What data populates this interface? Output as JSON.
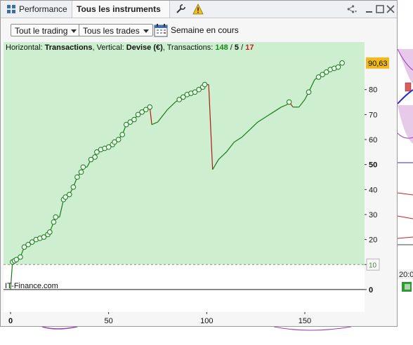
{
  "tabs": {
    "performance_label": "Performance",
    "instruments_label": "Tous les instruments"
  },
  "toolbar": {
    "trading_filter": "Tout le trading",
    "trades_filter": "Tous les trades",
    "period": "Semaine en cours"
  },
  "legend": {
    "horizontal_prefix": "Horizontal: ",
    "horizontal_value": "Transactions",
    "vertical_prefix": ", Vertical: ",
    "vertical_value": "Devise (€)",
    "transactions_prefix": ", Transactions: ",
    "total": "148",
    "sep1": " / ",
    "neutral": "5",
    "sep2": " / ",
    "losing": "17"
  },
  "watermark": "IT-Finance.com",
  "badges": {
    "last_value": "90,63",
    "threshold": "10"
  },
  "colors": {
    "up": "#1a7a1a",
    "down": "#b01818",
    "area": "#cdefcf",
    "badge": "#f1b91a"
  },
  "chart_data": {
    "type": "line",
    "xlim": [
      0,
      174
    ],
    "ylim": [
      -9,
      99
    ],
    "x_ticks": [
      "0",
      "50",
      "100",
      "150"
    ],
    "y_ticks": [
      "0",
      "10",
      "20",
      "30",
      "40",
      "50",
      "60",
      "70",
      "80"
    ],
    "threshold": 10,
    "last_value": 90.63,
    "points": [
      [
        0,
        0
      ],
      [
        1,
        11
      ],
      [
        2,
        11.5
      ],
      [
        3,
        12
      ],
      [
        5,
        13
      ],
      [
        7,
        17
      ],
      [
        9,
        18
      ],
      [
        11,
        19
      ],
      [
        13,
        20
      ],
      [
        15,
        20.5
      ],
      [
        17,
        21
      ],
      [
        19,
        22
      ],
      [
        20,
        23
      ],
      [
        22,
        27
      ],
      [
        23,
        29
      ],
      [
        25,
        29
      ],
      [
        27,
        36
      ],
      [
        28,
        37
      ],
      [
        30,
        38
      ],
      [
        32,
        41
      ],
      [
        34,
        45
      ],
      [
        36,
        47
      ],
      [
        37,
        49
      ],
      [
        39,
        49
      ],
      [
        41,
        52
      ],
      [
        43,
        53
      ],
      [
        44,
        55
      ],
      [
        46,
        56
      ],
      [
        48,
        56.5
      ],
      [
        50,
        57
      ],
      [
        52,
        58
      ],
      [
        53,
        59
      ],
      [
        55,
        60
      ],
      [
        57,
        62
      ],
      [
        59,
        66
      ],
      [
        61,
        67
      ],
      [
        63,
        68
      ],
      [
        65,
        70
      ],
      [
        67,
        71
      ],
      [
        69,
        72
      ],
      [
        71,
        73
      ],
      [
        72,
        66
      ],
      [
        75,
        67
      ],
      [
        80,
        72
      ],
      [
        84,
        75
      ],
      [
        86,
        76
      ],
      [
        88,
        77
      ],
      [
        90,
        78
      ],
      [
        92,
        78.5
      ],
      [
        94,
        79
      ],
      [
        96,
        80
      ],
      [
        98,
        81
      ],
      [
        99,
        82
      ],
      [
        101,
        82
      ],
      [
        103,
        48
      ],
      [
        106,
        52
      ],
      [
        110,
        55
      ],
      [
        114,
        59
      ],
      [
        118,
        61
      ],
      [
        122,
        64
      ],
      [
        126,
        67
      ],
      [
        130,
        69
      ],
      [
        134,
        71
      ],
      [
        138,
        73
      ],
      [
        141,
        74
      ],
      [
        142,
        75
      ],
      [
        144,
        73
      ],
      [
        147,
        73
      ],
      [
        150,
        76
      ],
      [
        152,
        79
      ],
      [
        155,
        84
      ],
      [
        157,
        85
      ],
      [
        159,
        86
      ],
      [
        161,
        87
      ],
      [
        163,
        88
      ],
      [
        165,
        88.5
      ],
      [
        167,
        89
      ],
      [
        169,
        90.63
      ]
    ],
    "down_segments": [
      [
        71,
        72
      ],
      [
        101,
        103
      ],
      [
        142,
        144
      ]
    ]
  },
  "background_app": {
    "time_label": "20:0"
  }
}
